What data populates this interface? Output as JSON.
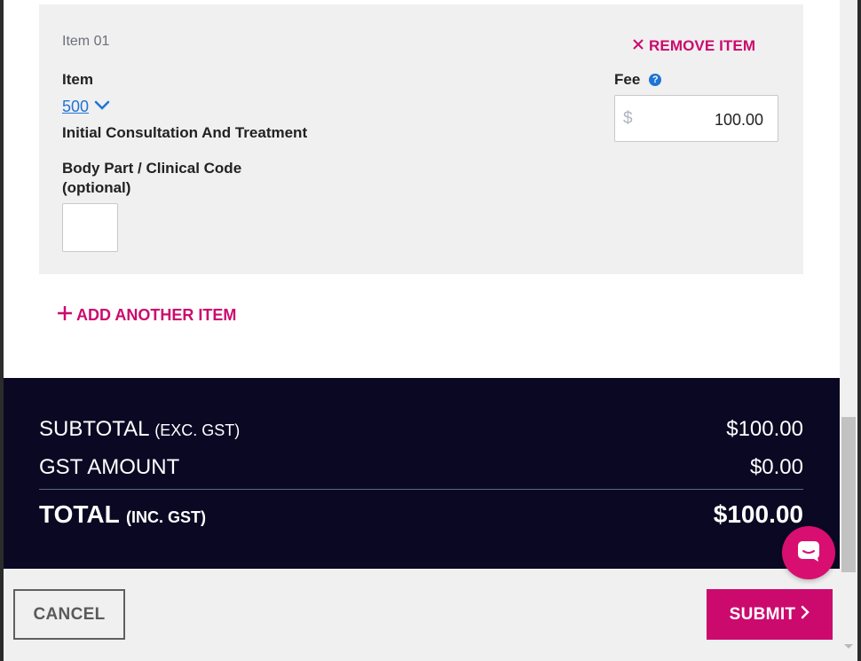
{
  "item": {
    "heading": "Item 01",
    "remove_label": "REMOVE ITEM",
    "item_label": "Item",
    "item_code": "500",
    "item_description": "Initial Consultation And Treatment",
    "body_part_label": "Body Part / Clinical Code (optional)",
    "body_part_value": "",
    "fee_label": "Fee",
    "fee_currency": "$",
    "fee_value": "100.00"
  },
  "add_item_label": "ADD ANOTHER ITEM",
  "totals": {
    "subtotal_label": "SUBTOTAL",
    "subtotal_sub": "(EXC. GST)",
    "subtotal_value": "$100.00",
    "gst_label": "GST AMOUNT",
    "gst_value": "$0.00",
    "total_label": "TOTAL",
    "total_sub": "(INC. GST)",
    "total_value": "$100.00"
  },
  "footer": {
    "cancel_label": "CANCEL",
    "submit_label": "SUBMIT"
  },
  "icons": {
    "remove": "close-icon",
    "add": "plus-icon",
    "dropdown": "chevron-down-icon",
    "help": "help-icon",
    "submit": "chevron-right-icon",
    "chat": "chat-icon"
  },
  "colors": {
    "accent": "#cc0a6e",
    "link": "#1f74d4",
    "totals_bg": "#0b0823",
    "panel_bg": "#f0f0f0"
  }
}
